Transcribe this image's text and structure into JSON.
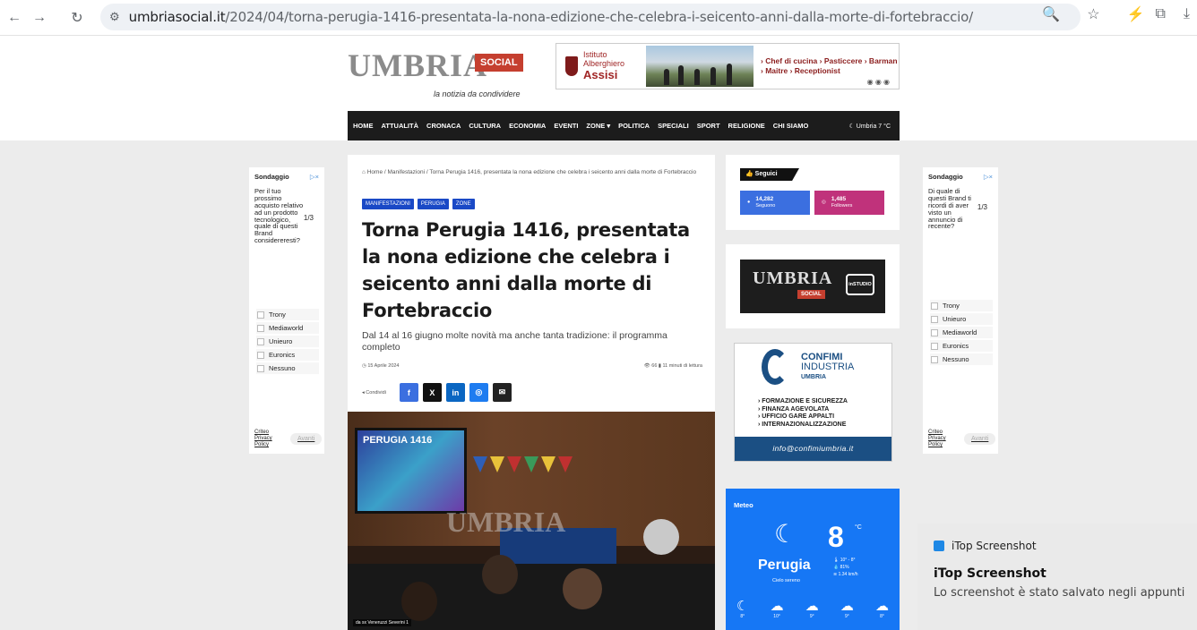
{
  "browser": {
    "url_host": "umbriasocial.it",
    "url_path": "/2024/04/torna-perugia-1416-presentata-la-nona-edizione-che-celebra-i-seicento-anni-dalla-morte-di-fortebraccio/"
  },
  "header": {
    "logo_text": "UMBRIA",
    "logo_badge": "SOCIAL",
    "tagline": "la notizia da condividere",
    "banner": {
      "school_line1": "Istituto",
      "school_line2": "Alberghiero",
      "school_name": "Assisi",
      "jobs_line1": "› Chef di cucina  › Pasticcere  › Barman",
      "jobs_line2": "› Maitre  › Receptionist"
    }
  },
  "nav": {
    "items": [
      "HOME",
      "ATTUALITÀ",
      "CRONACA",
      "CULTURA",
      "ECONOMIA",
      "EVENTI",
      "ZONE ▾",
      "POLITICA",
      "SPECIALI",
      "SPORT",
      "RELIGIONE",
      "CHI SIAMO"
    ],
    "weather": "☾  Umbria 7 °C"
  },
  "left_ad": {
    "title": "Sondaggio",
    "question": "Per il tuo prossimo acquisto relativo ad un prodotto tecnologico, quale di questi Brand considereresti?",
    "counter": "1/3",
    "options": [
      "Trony",
      "Mediaworld",
      "Unieuro",
      "Euronics",
      "Nessuno"
    ],
    "footer_link": "Criteo Privacy Policy",
    "next": "Avanti"
  },
  "right_ad": {
    "title": "Sondaggio",
    "question": "Di quale di questi Brand ti ricordi di aver visto un annuncio di recente?",
    "counter": "1/3",
    "options": [
      "Trony",
      "Unieuro",
      "Mediaworld",
      "Euronics",
      "Nessuno"
    ],
    "footer_link": "Criteo Privacy Policy",
    "next": "Avanti"
  },
  "article": {
    "breadcrumb": "⌂ Home / Manifestazioni / Torna Perugia 1416, presentata la nona edizione che celebra i seicento anni dalla morte di Fortebraccio",
    "tags": [
      "MANIFESTAZIONI",
      "PERUGIA",
      "ZONE"
    ],
    "title": "Torna Perugia 1416, presentata la nona edizione che celebra i seicento anni dalla morte di Fortebraccio",
    "subtitle": "Dal 14 al 16 giugno molte novità ma anche tanta tradizione: il programma completo",
    "date": "◷ 15 Aprile 2024",
    "stats": "👁 66   ▮ 11 minuti di lettura",
    "share_label": "◂ Condividi",
    "photo_screen_text": "PERUGIA 1416",
    "photo_watermark": "UMBRIA",
    "photo_credit": "da sx Veneruzzi Severini 1"
  },
  "social": {
    "header": "Seguici",
    "facebook_count": "14,282",
    "facebook_label": "Seguono",
    "instagram_count": "1,485",
    "instagram_label": "Followers"
  },
  "studio": {
    "logo": "UMBRIA",
    "badge": "SOCIAL",
    "bubble": "inSTUDIO"
  },
  "confimi": {
    "name": "CONFIMI",
    "name2": "INDUSTRIA",
    "region": "UMBRIA",
    "list": [
      "› FORMAZIONE E SICUREZZA",
      "› FINANZA AGEVOLATA",
      "› UFFICIO GARE APPALTI",
      "› INTERNAZIONALIZZAZIONE"
    ],
    "email": "info@confimiumbria.it"
  },
  "meteo": {
    "title": "Meteo",
    "temp": "8",
    "unit": "°C",
    "city": "Perugia",
    "condition": "Cielo sereno",
    "stats": [
      "🌡 10° - 8°",
      "💧 81%",
      "≋ 1.34 km/h"
    ],
    "days": [
      "8°",
      "10°",
      "9°",
      "9°",
      "8°"
    ]
  },
  "toast": {
    "app": "iTop Screenshot",
    "title": "iTop Screenshot",
    "body": "Lo screenshot è stato salvato negli appunti"
  },
  "colors": {
    "nav_bg": "#1c1c1c",
    "tag_blue": "#1a49c6",
    "facebook": "#3b6fe0",
    "instagram": "#c0327b",
    "meteo": "#1677f5",
    "brand_red": "#c53f2f"
  }
}
